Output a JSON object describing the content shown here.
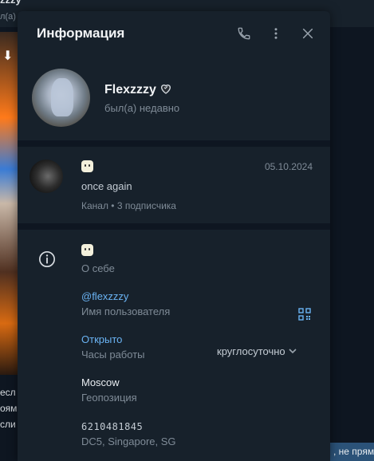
{
  "background": {
    "top_title": "zzzy",
    "top_subtitle": "л(а)",
    "left_text_lines": [
      "есл",
      "оям",
      "сли"
    ],
    "right_bottom_text": ", не прям"
  },
  "header": {
    "title": "Информация",
    "icons": [
      "phone-icon",
      "more-vert-icon",
      "close-icon"
    ]
  },
  "profile": {
    "name": "Flexzzzy",
    "status": "был(а) недавно"
  },
  "channel": {
    "date": "05.10.2024",
    "text": "once again",
    "meta": "Канал • 3 подписчика"
  },
  "info": {
    "about_label": "О себе",
    "username": "@flexzzzy",
    "username_label": "Имя пользователя",
    "hours_status": "Открыто",
    "hours_label": "Часы работы",
    "hours_value": "круглосуточно",
    "location": "Moscow",
    "location_label": "Геопозиция",
    "id": "6210481845",
    "dc": "DC5, Singapore, SG"
  },
  "colors": {
    "panel": "#17212b",
    "background": "#0e1621",
    "link": "#6ab3f3",
    "muted": "#7f8b97"
  }
}
